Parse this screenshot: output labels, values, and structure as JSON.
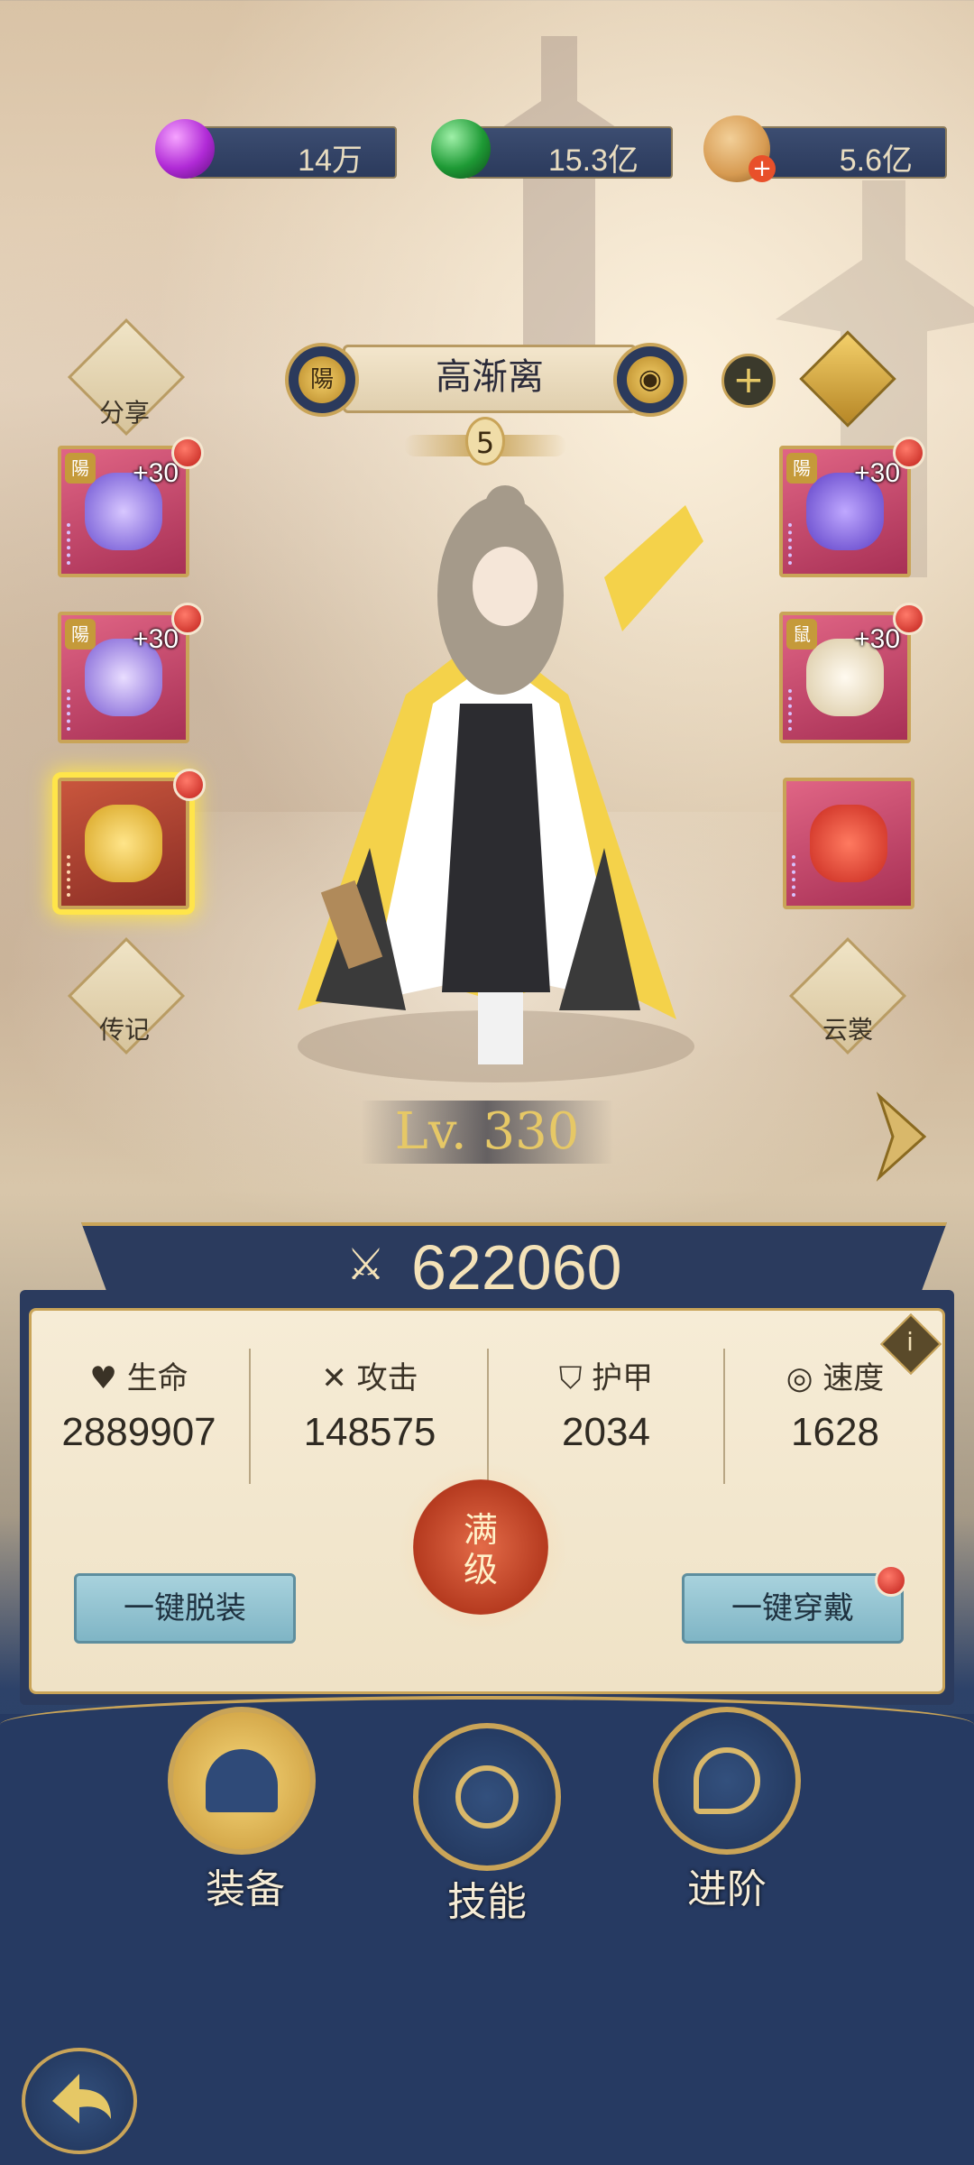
{
  "currencies": [
    {
      "name": "purple-gem",
      "value": "14万",
      "color": "#b02ad6"
    },
    {
      "name": "green-jade",
      "value": "15.3亿",
      "color": "#1e9a35"
    },
    {
      "name": "copper-coin",
      "value": "5.6亿",
      "color": "#d79b52"
    }
  ],
  "hero": {
    "name": "高渐离",
    "left_badge": "陽",
    "star_rank": "5",
    "level": "Lv. 330",
    "power": "622060"
  },
  "side_menu": {
    "share": "分享",
    "biography": "传记",
    "skins": "云裳"
  },
  "equipment": {
    "left": [
      {
        "tag": "陽",
        "plus": "+30",
        "color": "#6a4fd1"
      },
      {
        "tag": "陽",
        "plus": "+30",
        "color": "#7a5cd4"
      },
      {
        "tag": "",
        "plus": "",
        "color": "#d6a21e"
      }
    ],
    "right": [
      {
        "tag": "陽",
        "plus": "+30",
        "color": "#5d3fc6"
      },
      {
        "tag": "鼠",
        "plus": "+30",
        "color": "#d8c7a0"
      },
      {
        "tag": "",
        "plus": "",
        "color": "#c8281e"
      }
    ]
  },
  "stats": [
    {
      "label": "生命",
      "icon": "heart-icon",
      "value": "2889907"
    },
    {
      "label": "攻击",
      "icon": "crossed-swords-icon",
      "value": "148575"
    },
    {
      "label": "护甲",
      "icon": "shield-icon",
      "value": "2034"
    },
    {
      "label": "速度",
      "icon": "swirl-icon",
      "value": "1628"
    }
  ],
  "actions": {
    "unequip_all": "一键脱装",
    "equip_all": "一键穿戴",
    "max_level": "满级"
  },
  "tabs": [
    {
      "label": "装备",
      "selected": true
    },
    {
      "label": "技能",
      "selected": false
    },
    {
      "label": "进阶",
      "selected": false
    }
  ]
}
